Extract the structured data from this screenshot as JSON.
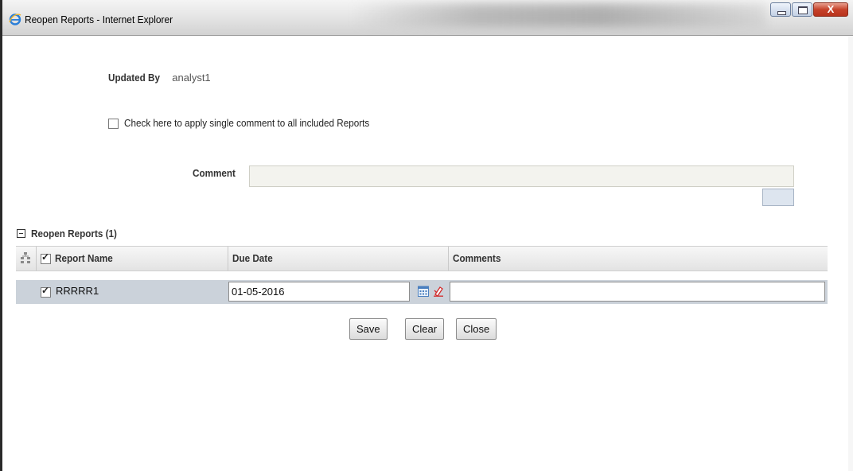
{
  "window": {
    "title": "Reopen Reports - Internet Explorer",
    "close_glyph": "X"
  },
  "form": {
    "updated_by_label": "Updated By",
    "updated_by_value": "analyst1",
    "single_comment_label": "Check here to apply single comment to all included Reports",
    "single_comment_checked": false,
    "comment_label": "Comment",
    "comment_value": ""
  },
  "section": {
    "title": "Reopen Reports (1)"
  },
  "grid": {
    "columns": [
      "Report Name",
      "Due Date",
      "Comments"
    ],
    "rows": [
      {
        "report_name": "RRRRR1",
        "due_date": "01-05-2016",
        "comments": "",
        "checked": true
      }
    ]
  },
  "buttons": {
    "save": "Save",
    "clear": "Clear",
    "close": "Close"
  },
  "icons": [
    "ie-icon",
    "minimize-icon",
    "maximize-icon",
    "close-icon",
    "collapse-icon",
    "tree-icon",
    "calendar-icon",
    "clear-date-icon"
  ],
  "colors": {
    "row_selected": "#cbd2da",
    "close_button": "#c6422a"
  }
}
